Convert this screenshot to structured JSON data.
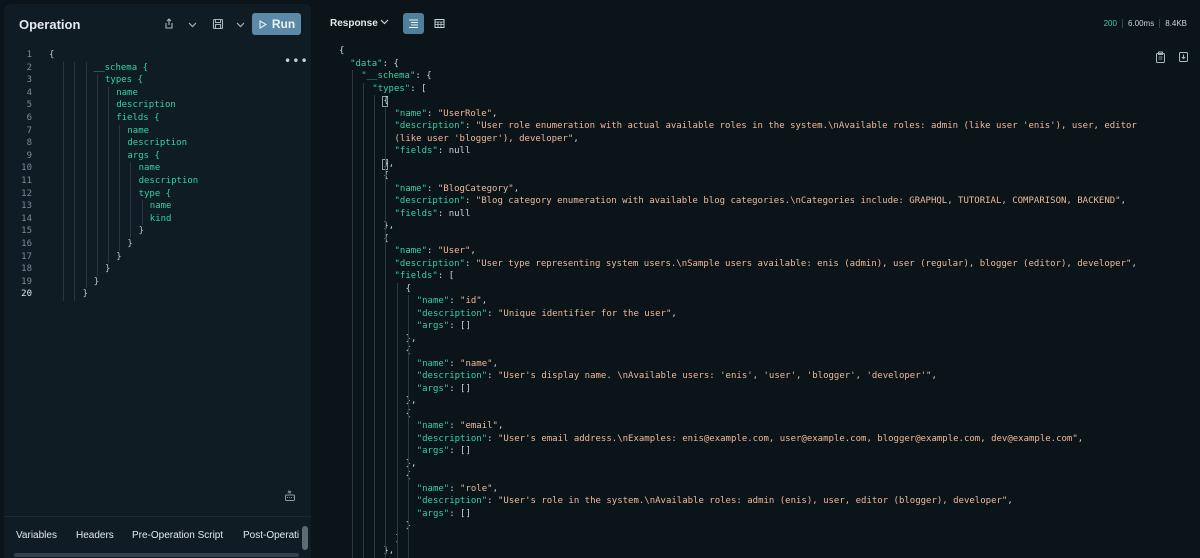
{
  "operation": {
    "title": "Operation",
    "run_label": "Run",
    "more": "•••",
    "lines": [
      {
        "n": "1",
        "indent": 0,
        "text": "{",
        "type": "brace"
      },
      {
        "n": "2",
        "indent": 4,
        "text": "__schema {",
        "type": "field"
      },
      {
        "n": "3",
        "indent": 5,
        "text": "types {",
        "type": "field"
      },
      {
        "n": "4",
        "indent": 6,
        "text": "name",
        "type": "field"
      },
      {
        "n": "5",
        "indent": 6,
        "text": "description",
        "type": "field"
      },
      {
        "n": "6",
        "indent": 6,
        "text": "fields {",
        "type": "field"
      },
      {
        "n": "7",
        "indent": 7,
        "text": "name",
        "type": "field"
      },
      {
        "n": "8",
        "indent": 7,
        "text": "description",
        "type": "field"
      },
      {
        "n": "9",
        "indent": 7,
        "text": "args {",
        "type": "field"
      },
      {
        "n": "10",
        "indent": 8,
        "text": "name",
        "type": "field"
      },
      {
        "n": "11",
        "indent": 8,
        "text": "description",
        "type": "field"
      },
      {
        "n": "12",
        "indent": 8,
        "text": "type {",
        "type": "field"
      },
      {
        "n": "13",
        "indent": 9,
        "text": "name",
        "type": "field"
      },
      {
        "n": "14",
        "indent": 9,
        "text": "kind",
        "type": "field"
      },
      {
        "n": "15",
        "indent": 8,
        "text": "}",
        "type": "brace"
      },
      {
        "n": "16",
        "indent": 7,
        "text": "}",
        "type": "brace"
      },
      {
        "n": "17",
        "indent": 6,
        "text": "}",
        "type": "brace"
      },
      {
        "n": "18",
        "indent": 5,
        "text": "}",
        "type": "brace"
      },
      {
        "n": "19",
        "indent": 4,
        "text": "}",
        "type": "brace"
      },
      {
        "n": "20",
        "indent": 3,
        "text": "}",
        "type": "brace"
      }
    ],
    "active_line": "20"
  },
  "bottom_tabs": [
    "Variables",
    "Headers",
    "Pre-Operation Script",
    "Post-Operati"
  ],
  "response": {
    "title": "Response",
    "status": "200",
    "time": "6.00ms",
    "size": "8.4KB",
    "lines": [
      {
        "i": 0,
        "t": [
          [
            "p",
            "{"
          ]
        ]
      },
      {
        "i": 1,
        "t": [
          [
            "k",
            "\"data\""
          ],
          [
            "p",
            ": {"
          ]
        ]
      },
      {
        "i": 2,
        "t": [
          [
            "k",
            "\"__schema\""
          ],
          [
            "p",
            ": {"
          ]
        ]
      },
      {
        "i": 3,
        "t": [
          [
            "k",
            "\"types\""
          ],
          [
            "p",
            ": ["
          ]
        ]
      },
      {
        "i": 4,
        "t": [
          [
            "p",
            "{"
          ]
        ],
        "cursor": true
      },
      {
        "i": 5,
        "t": [
          [
            "k",
            "\"name\""
          ],
          [
            "p",
            ": "
          ],
          [
            "s",
            "\"UserRole\""
          ],
          [
            "p",
            ","
          ]
        ]
      },
      {
        "i": 5,
        "t": [
          [
            "k",
            "\"description\""
          ],
          [
            "p",
            ": "
          ],
          [
            "s",
            "\"User role enumeration with actual available roles in the system.\\nAvailable roles: admin (like user 'enis'), user, editor"
          ]
        ]
      },
      {
        "i": 5,
        "t": [
          [
            "s",
            "(like user 'blogger'), developer\""
          ],
          [
            "p",
            ","
          ]
        ]
      },
      {
        "i": 5,
        "t": [
          [
            "k",
            "\"fields\""
          ],
          [
            "p",
            ": null"
          ]
        ]
      },
      {
        "i": 4,
        "t": [
          [
            "p",
            "},"
          ]
        ],
        "cursor": true
      },
      {
        "i": 4,
        "t": [
          [
            "p",
            "{"
          ]
        ]
      },
      {
        "i": 5,
        "t": [
          [
            "k",
            "\"name\""
          ],
          [
            "p",
            ": "
          ],
          [
            "s",
            "\"BlogCategory\""
          ],
          [
            "p",
            ","
          ]
        ]
      },
      {
        "i": 5,
        "t": [
          [
            "k",
            "\"description\""
          ],
          [
            "p",
            ": "
          ],
          [
            "s",
            "\"Blog category enumeration with available blog categories.\\nCategories include: GRAPHQL, TUTORIAL, COMPARISON, BACKEND\""
          ],
          [
            "p",
            ","
          ]
        ]
      },
      {
        "i": 5,
        "t": [
          [
            "k",
            "\"fields\""
          ],
          [
            "p",
            ": null"
          ]
        ]
      },
      {
        "i": 4,
        "t": [
          [
            "p",
            "},"
          ]
        ]
      },
      {
        "i": 4,
        "t": [
          [
            "p",
            "{"
          ]
        ]
      },
      {
        "i": 5,
        "t": [
          [
            "k",
            "\"name\""
          ],
          [
            "p",
            ": "
          ],
          [
            "s",
            "\"User\""
          ],
          [
            "p",
            ","
          ]
        ]
      },
      {
        "i": 5,
        "t": [
          [
            "k",
            "\"description\""
          ],
          [
            "p",
            ": "
          ],
          [
            "s",
            "\"User type representing system users.\\nSample users available: enis (admin), user (regular), blogger (editor), developer\""
          ],
          [
            "p",
            ","
          ]
        ]
      },
      {
        "i": 5,
        "t": [
          [
            "k",
            "\"fields\""
          ],
          [
            "p",
            ": ["
          ]
        ]
      },
      {
        "i": 6,
        "t": [
          [
            "p",
            "{"
          ]
        ]
      },
      {
        "i": 7,
        "t": [
          [
            "k",
            "\"name\""
          ],
          [
            "p",
            ": "
          ],
          [
            "s",
            "\"id\""
          ],
          [
            "p",
            ","
          ]
        ]
      },
      {
        "i": 7,
        "t": [
          [
            "k",
            "\"description\""
          ],
          [
            "p",
            ": "
          ],
          [
            "s",
            "\"Unique identifier for the user\""
          ],
          [
            "p",
            ","
          ]
        ]
      },
      {
        "i": 7,
        "t": [
          [
            "k",
            "\"args\""
          ],
          [
            "p",
            ": []"
          ]
        ]
      },
      {
        "i": 6,
        "t": [
          [
            "p",
            "},"
          ]
        ]
      },
      {
        "i": 6,
        "t": [
          [
            "p",
            "{"
          ]
        ]
      },
      {
        "i": 7,
        "t": [
          [
            "k",
            "\"name\""
          ],
          [
            "p",
            ": "
          ],
          [
            "s",
            "\"name\""
          ],
          [
            "p",
            ","
          ]
        ]
      },
      {
        "i": 7,
        "t": [
          [
            "k",
            "\"description\""
          ],
          [
            "p",
            ": "
          ],
          [
            "s",
            "\"User's display name. \\nAvailable users: 'enis', 'user', 'blogger', 'developer'\""
          ],
          [
            "p",
            ","
          ]
        ]
      },
      {
        "i": 7,
        "t": [
          [
            "k",
            "\"args\""
          ],
          [
            "p",
            ": []"
          ]
        ]
      },
      {
        "i": 6,
        "t": [
          [
            "p",
            "},"
          ]
        ]
      },
      {
        "i": 6,
        "t": [
          [
            "p",
            "{"
          ]
        ]
      },
      {
        "i": 7,
        "t": [
          [
            "k",
            "\"name\""
          ],
          [
            "p",
            ": "
          ],
          [
            "s",
            "\"email\""
          ],
          [
            "p",
            ","
          ]
        ]
      },
      {
        "i": 7,
        "t": [
          [
            "k",
            "\"description\""
          ],
          [
            "p",
            ": "
          ],
          [
            "s",
            "\"User's email address.\\nExamples: enis@example.com, user@example.com, blogger@example.com, dev@example.com\""
          ],
          [
            "p",
            ","
          ]
        ]
      },
      {
        "i": 7,
        "t": [
          [
            "k",
            "\"args\""
          ],
          [
            "p",
            ": []"
          ]
        ]
      },
      {
        "i": 6,
        "t": [
          [
            "p",
            "},"
          ]
        ]
      },
      {
        "i": 6,
        "t": [
          [
            "p",
            "{"
          ]
        ]
      },
      {
        "i": 7,
        "t": [
          [
            "k",
            "\"name\""
          ],
          [
            "p",
            ": "
          ],
          [
            "s",
            "\"role\""
          ],
          [
            "p",
            ","
          ]
        ]
      },
      {
        "i": 7,
        "t": [
          [
            "k",
            "\"description\""
          ],
          [
            "p",
            ": "
          ],
          [
            "s",
            "\"User's role in the system.\\nAvailable roles: admin (enis), user, editor (blogger), developer\""
          ],
          [
            "p",
            ","
          ]
        ]
      },
      {
        "i": 7,
        "t": [
          [
            "k",
            "\"args\""
          ],
          [
            "p",
            ": []"
          ]
        ]
      },
      {
        "i": 6,
        "t": [
          [
            "p",
            "}"
          ]
        ]
      },
      {
        "i": 5,
        "t": [
          [
            "p",
            "]"
          ]
        ]
      },
      {
        "i": 4,
        "t": [
          [
            "p",
            "},"
          ]
        ]
      }
    ]
  },
  "icons": {
    "share": "share-icon",
    "save": "save-icon",
    "play": "play-icon",
    "prettify": "prettify-icon",
    "copy": "copy-icon",
    "download": "download-icon",
    "text_view": "text-view-icon",
    "table_view": "table-view-icon"
  },
  "colors": {
    "accent": "#5c8aa6",
    "field": "#2fd3a8",
    "string": "#f0b89a",
    "status_ok": "#2fd3a8"
  }
}
